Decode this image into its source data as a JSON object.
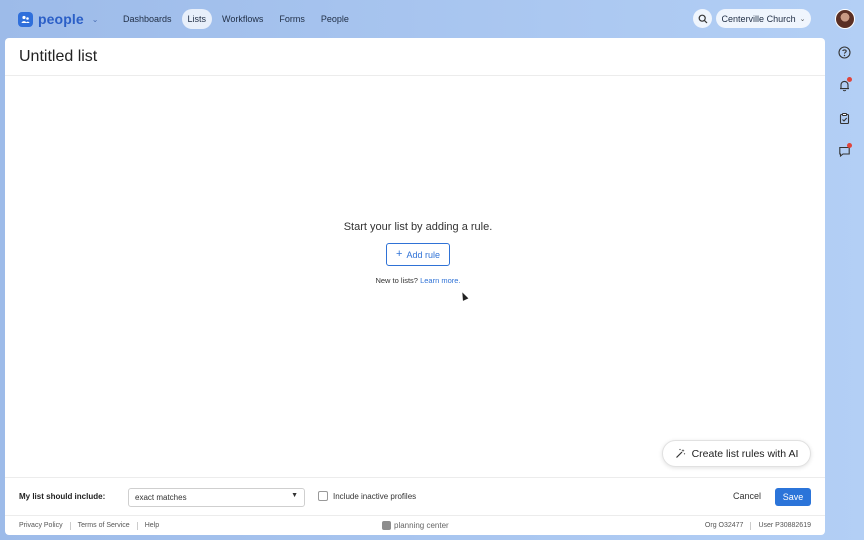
{
  "nav": {
    "brand": "people",
    "links": [
      "Dashboards",
      "Lists",
      "Workflows",
      "Forms",
      "People"
    ],
    "active": "Lists",
    "org": "Centerville Church"
  },
  "header": {
    "title": "Untitled list"
  },
  "empty": {
    "text": "Start your list by adding a rule.",
    "add_rule": "Add rule",
    "learn_prefix": "New to lists?",
    "learn_link": "Learn more."
  },
  "ai_button": "Create list rules with AI",
  "footer_bar": {
    "include_label": "My list should include:",
    "match_value": "exact matches",
    "inactive_label": "Include inactive profiles",
    "cancel": "Cancel",
    "save": "Save"
  },
  "page_footer": {
    "links": [
      "Privacy Policy",
      "Terms of Service",
      "Help"
    ],
    "brand": "planning center",
    "org_id": "Org O32477",
    "user_id": "User P30882619"
  },
  "colors": {
    "accent": "#2f72d6",
    "save": "#2b74d9",
    "notify": "#e0443b"
  }
}
